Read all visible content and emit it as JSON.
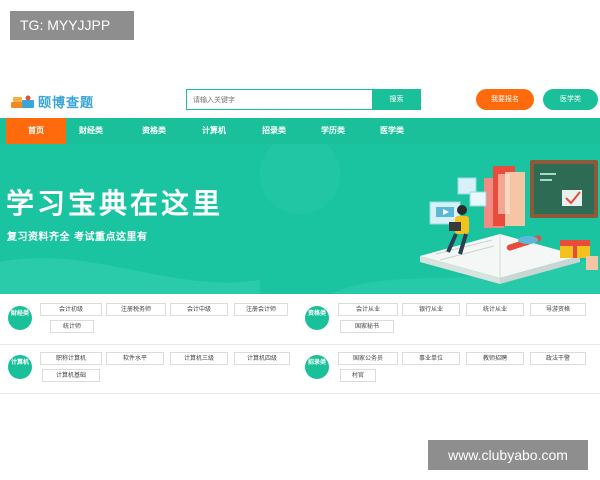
{
  "watermarks": {
    "top": "TG: MYYJJPP",
    "bottom": "www.clubyabo.com"
  },
  "header": {
    "logo_text": "颐博查题",
    "search_placeholder": "请输入关键字",
    "search_button": "搜索",
    "signup_button": "我要报名",
    "medical_button": "医学类"
  },
  "nav": {
    "items": [
      {
        "label": "首页",
        "active": true
      },
      {
        "label": "财经类",
        "active": false
      },
      {
        "label": "资格类",
        "active": false
      },
      {
        "label": "计算机",
        "active": false
      },
      {
        "label": "招录类",
        "active": false
      },
      {
        "label": "学历类",
        "active": false
      },
      {
        "label": "医学类",
        "active": false
      }
    ]
  },
  "banner": {
    "title": "学习宝典在这里",
    "subtitle": "复习资料齐全 考试重点这里有"
  },
  "categories": [
    {
      "name": "财经类",
      "items": [
        "会计初级",
        "注册税务师",
        "会计中级",
        "注册会计师",
        "统计师"
      ]
    },
    {
      "name": "资格类",
      "items": [
        "会计从业",
        "银行从业",
        "统计从业",
        "导游资格",
        "国家秘书"
      ]
    },
    {
      "name": "计算机",
      "items": [
        "职称计算机",
        "软件水平",
        "计算机三级",
        "计算机四级",
        "计算机基础"
      ]
    },
    {
      "name": "招录类",
      "items": [
        "国家公务员",
        "事业单位",
        "教师招聘",
        "政法干警",
        "村官"
      ]
    }
  ],
  "colors": {
    "primary": "#19c09a",
    "accent": "#ff6a0d",
    "logo": "#3aa6d8"
  }
}
